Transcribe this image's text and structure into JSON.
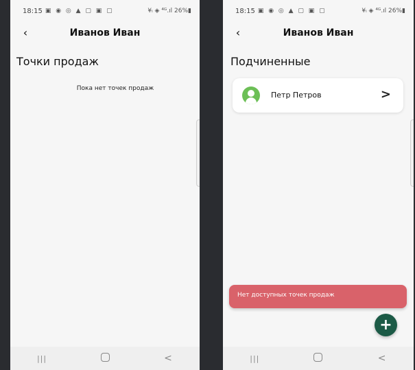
{
  "left_screen": {
    "status_bar": {
      "time": "18:15",
      "icons": "▣ ◉ ◎ ▲ ▢ ▣ ▢",
      "right": "¥ᵢ ◈ ⁴ᴳ.ıl 26%▮"
    },
    "header": {
      "back": "‹",
      "title": "Иванов Иван"
    },
    "section_title": "Точки продаж",
    "empty_text": "Пока нет точек продаж",
    "nav": {
      "recent": "|||",
      "back": "<"
    }
  },
  "right_screen": {
    "status_bar": {
      "time": "18:15",
      "icons": "▣ ◉ ◎ ▲ ▢ ▣ ▢",
      "right": "¥ᵢ ◈ ⁴ᴳ.ıl 26%▮"
    },
    "header": {
      "back": "‹",
      "title": "Иванов Иван"
    },
    "section_title": "Подчиненные",
    "subordinates": [
      {
        "name": "Петр Петров",
        "chevron": ">"
      }
    ],
    "snackbar": "Нет доступных точек продаж",
    "fab": "+",
    "nav": {
      "recent": "|||",
      "back": "<"
    }
  },
  "colors": {
    "avatar": "#6cbf56",
    "snackbar": "#d9626a",
    "fab": "#1c5a46",
    "background": "#f6f6f6"
  }
}
